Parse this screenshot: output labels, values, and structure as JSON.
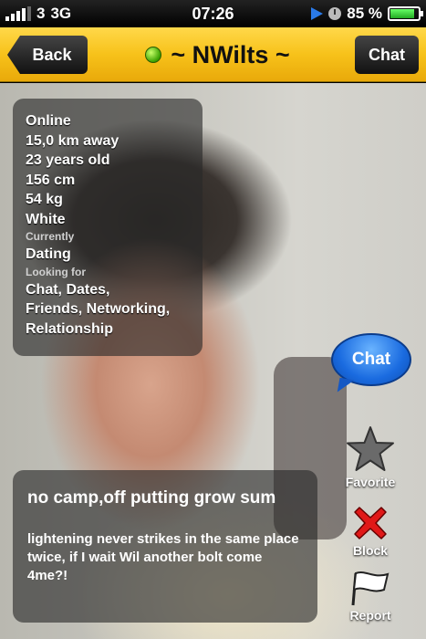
{
  "status_bar": {
    "carrier": "3",
    "network": "3G",
    "time": "07:26",
    "battery": "85 %",
    "battery_level": 0.85
  },
  "nav": {
    "back_label": "Back",
    "title": "~ NWilts ~",
    "chat_label": "Chat",
    "online_color": "#3aa000"
  },
  "profile": {
    "status": "Online",
    "distance": "15,0 km away",
    "age": "23 years old",
    "height": "156 cm",
    "weight": "54 kg",
    "ethnicity": "White",
    "currently_label": "Currently",
    "currently": "Dating",
    "looking_for_label": "Looking for",
    "looking_for_line1": "Chat, Dates,",
    "looking_for_line2": "Friends, Networking,",
    "looking_for_line3": "Relationship"
  },
  "about": {
    "headline": "no camp,off putting grow sum",
    "body": "lightening never strikes in the same place twice, if I wait Wil another bolt come 4me?!"
  },
  "actions": {
    "chat_label": "Chat",
    "favorite_label": "Favorite",
    "block_label": "Block",
    "report_label": "Report"
  },
  "colors": {
    "nav_bar": "#f7c21a",
    "chat_bubble": "#1a6be0",
    "block": "#e01818"
  }
}
